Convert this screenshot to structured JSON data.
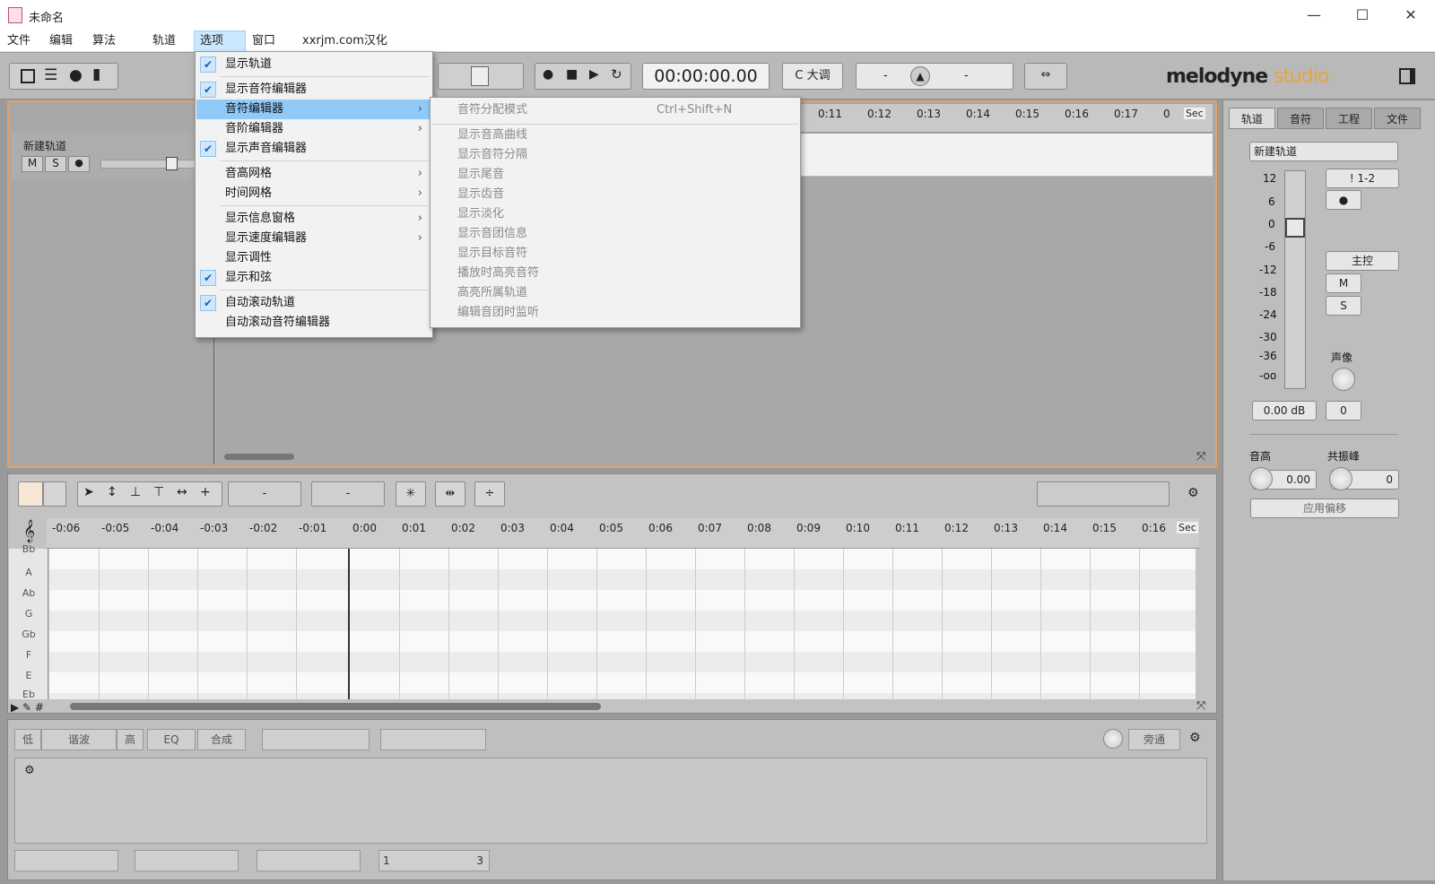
{
  "window": {
    "title": "未命名",
    "minimize": "—",
    "maximize": "☐",
    "close": "✕"
  },
  "menubar": [
    "文件",
    "编辑",
    "算法",
    "轨道",
    "选项",
    "窗口",
    "xxrjm.com汉化"
  ],
  "toolbar": {
    "time": "00:00:00.00",
    "key": "C 大调",
    "tempo_left": "-",
    "tempo_right": "-",
    "logo_main": "melodyne",
    "logo_sub": "studio"
  },
  "arrange": {
    "track_name": "新建轨道",
    "mute": "M",
    "solo": "S",
    "ruler_ticks": [
      "0:11",
      "0:12",
      "0:13",
      "0:14",
      "0:15",
      "0:16",
      "0:17",
      "0"
    ],
    "unit": "Sec"
  },
  "options_menu": {
    "items": [
      {
        "label": "显示轨道",
        "checked": true,
        "sub": false
      },
      {
        "label": "显示音符编辑器",
        "checked": true,
        "sub": false
      },
      {
        "label": "音符编辑器",
        "checked": false,
        "sub": true,
        "highlight": true
      },
      {
        "label": "音阶编辑器",
        "checked": false,
        "sub": true
      },
      {
        "label": "显示声音编辑器",
        "checked": true,
        "sub": false
      },
      {
        "label": "音高网格",
        "checked": false,
        "sub": true
      },
      {
        "label": "时间网格",
        "checked": false,
        "sub": true
      },
      {
        "label": "显示信息窗格",
        "checked": false,
        "sub": true
      },
      {
        "label": "显示速度编辑器",
        "checked": false,
        "sub": true
      },
      {
        "label": "显示调性",
        "checked": false,
        "sub": false
      },
      {
        "label": "显示和弦",
        "checked": true,
        "sub": false
      },
      {
        "label": "自动滚动轨道",
        "checked": true,
        "sub": false
      },
      {
        "label": "自动滚动音符编辑器",
        "checked": false,
        "sub": false
      }
    ]
  },
  "note_submenu": {
    "items": [
      "音符分配模式",
      "显示音高曲线",
      "显示音符分隔",
      "显示尾音",
      "显示齿音",
      "显示淡化",
      "显示音团信息",
      "显示目标音符",
      "播放时高亮音符",
      "高亮所属轨道",
      "编辑音团时监听"
    ],
    "shortcut": "Ctrl+Shift+N"
  },
  "editor": {
    "field1": "-",
    "field2": "-",
    "ruler_ticks": [
      "-0:06",
      "-0:05",
      "-0:04",
      "-0:03",
      "-0:02",
      "-0:01",
      "0:00",
      "0:01",
      "0:02",
      "0:03",
      "0:04",
      "0:05",
      "0:06",
      "0:07",
      "0:08",
      "0:09",
      "0:10",
      "0:11",
      "0:12",
      "0:13",
      "0:14",
      "0:15",
      "0:16"
    ],
    "unit": "Sec",
    "pitches": [
      "Bb",
      "A",
      "Ab",
      "G",
      "Gb",
      "F",
      "E",
      "Eb"
    ]
  },
  "bottom": {
    "tabs": [
      "低",
      "谐波",
      "高",
      "EQ",
      "合成"
    ],
    "bypass": "旁通",
    "page_left": "1",
    "page_right": "3"
  },
  "inspector": {
    "tabs": [
      "轨道",
      "音符",
      "工程",
      "文件"
    ],
    "track_name": "新建轨道",
    "scale": [
      "12",
      "6",
      "0",
      "-6",
      "-12",
      "-18",
      "-24",
      "-30",
      "-36",
      "-oo"
    ],
    "output": "! 1-2",
    "master": "主控",
    "mute": "M",
    "solo": "S",
    "pan_label": "声像",
    "gain": "0.00 dB",
    "pan": "0",
    "pitch_label": "音高",
    "pitch_value": "0.00",
    "formant_label": "共振峰",
    "formant_value": "0",
    "apply_offset": "应用偏移"
  }
}
